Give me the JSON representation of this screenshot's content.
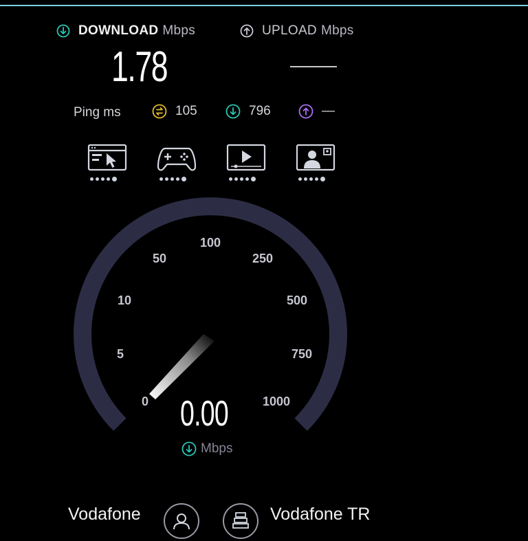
{
  "download": {
    "label": "DOWNLOAD",
    "unit": "Mbps",
    "value": "1.78"
  },
  "upload": {
    "label": "UPLOAD",
    "unit": "Mbps",
    "value_placeholder": "—"
  },
  "ping": {
    "label": "Ping ms",
    "idle": "105",
    "download": "796",
    "upload": "—"
  },
  "activities": [
    "web-browsing-icon",
    "gaming-icon",
    "video-streaming-icon",
    "video-call-icon"
  ],
  "gauge": {
    "scale_labels": [
      "0",
      "5",
      "10",
      "50",
      "100",
      "250",
      "500",
      "750",
      "1000"
    ],
    "current_speed": "0.00",
    "unit": "Mbps"
  },
  "footer": {
    "provider": "Vodafone",
    "server": "Vodafone TR"
  },
  "colors": {
    "accent_download": "#27c7b4",
    "accent_ping": "#e5b92f",
    "accent_upload": "#a970f2",
    "gauge_track": "#2c2d45"
  }
}
